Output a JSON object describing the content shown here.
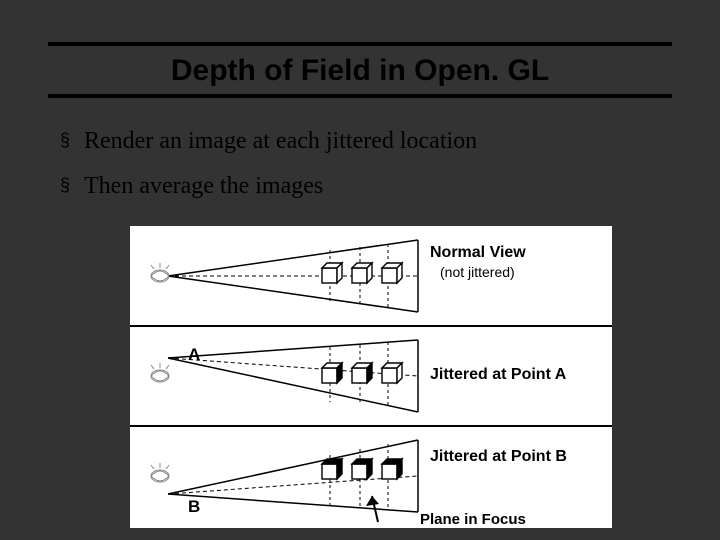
{
  "title": "Depth of Field in Open. GL",
  "bullets": {
    "b1": "Render an image at each jittered location",
    "b2": "Then average the images"
  },
  "diagram": {
    "normalView": "Normal View",
    "notJittered": "(not   jittered)",
    "jitteredA": "Jittered at Point A",
    "jitteredB": "Jittered at Point B",
    "planeInFocus": "Plane in Focus",
    "A": "A",
    "B": "B"
  }
}
